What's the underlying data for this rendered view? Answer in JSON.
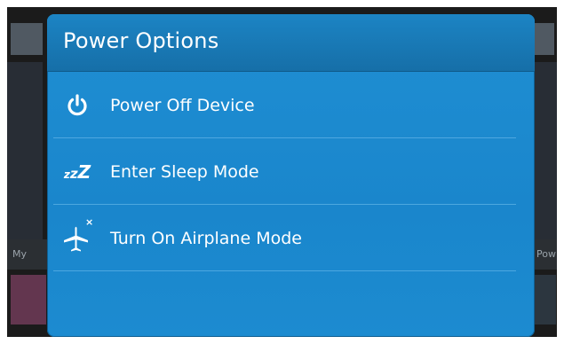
{
  "dialog": {
    "title": "Power Options"
  },
  "menu": {
    "items": [
      {
        "label": "Power Off Device",
        "icon": "power-icon"
      },
      {
        "label": "Enter Sleep Mode",
        "icon": "sleep-icon",
        "glyph": [
          "z",
          "z",
          "Z"
        ]
      },
      {
        "label": "Turn On Airplane Mode",
        "icon": "airplane-icon",
        "badge": "×"
      }
    ]
  },
  "background": {
    "left_text": "My",
    "right_text": "Pow"
  },
  "colors": {
    "dialog_blue": "#1a86cc",
    "header_blue": "#166fa8",
    "divider": "#5fb3e6",
    "text": "#ffffff"
  }
}
